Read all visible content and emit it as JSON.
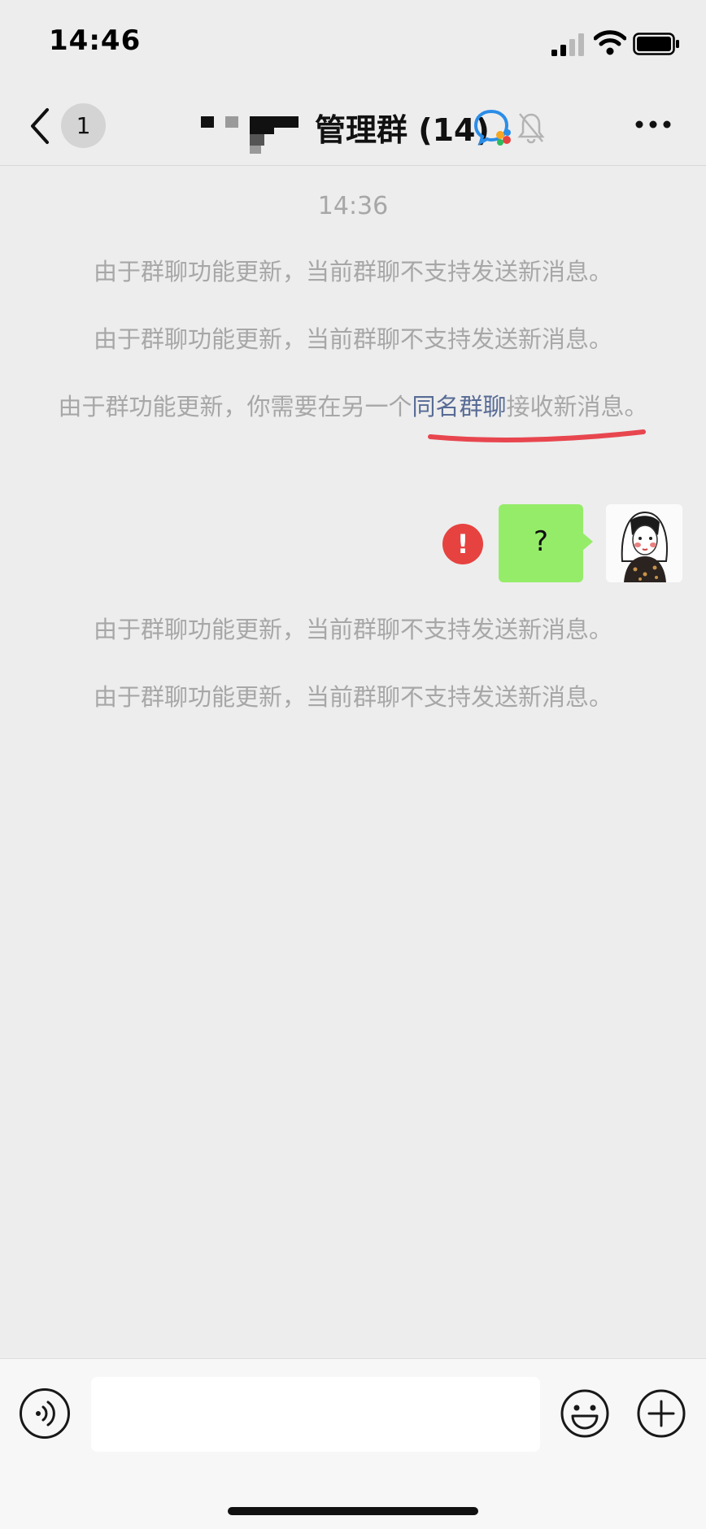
{
  "status_bar": {
    "time": "14:46"
  },
  "nav": {
    "unread_count": "1",
    "title": "管理群 (14)"
  },
  "messages": {
    "timestamp": "14:36",
    "system_1": "由于群聊功能更新，当前群聊不支持发送新消息。",
    "system_2": "由于群聊功能更新，当前群聊不支持发送新消息。",
    "system_3_prefix": "由于群功能更新，你需要在另一个",
    "system_3_link": "同名群聊",
    "system_3_suffix": "接收新消息。",
    "sent_text": "?",
    "sent_error": "!",
    "system_4": "由于群聊功能更新，当前群聊不支持发送新消息。",
    "system_5": "由于群聊功能更新，当前群聊不支持发送新消息。"
  },
  "input_bar": {
    "input_value": ""
  },
  "colors": {
    "background": "#ededed",
    "bubble_green": "#95ec69",
    "error_red": "#e64340",
    "link_blue": "#576b95",
    "annotation_red": "#e8464f"
  },
  "icons": [
    "back-icon",
    "wecom-icon",
    "mute-bell-icon",
    "more-icon",
    "error-icon",
    "voice-icon",
    "emoji-icon",
    "plus-icon"
  ]
}
